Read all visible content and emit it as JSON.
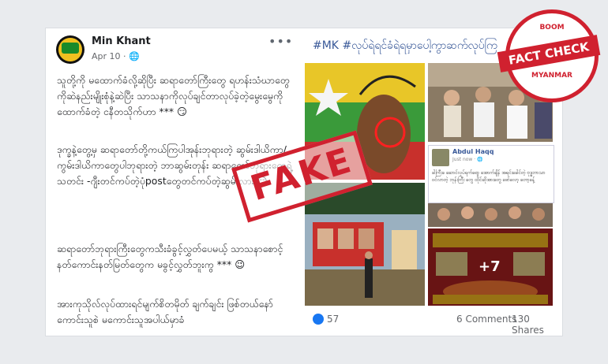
{
  "post": {
    "author": "Min Khant",
    "date": "Apr 10 · ",
    "more": "•••",
    "paragraphs": [
      "သူတို့ကို မထောက်ခံလို့ဆိုပြီး ဆရာတော်ကြီးတွေ ရဟန်းသံဃာတွေကိုဆဲနည်းမျိုးစုံနဲ့ဆဲပြီး သာသနာကိုလုပ်ချင်တာလုပ်ခဲ့တဲ့မွေးမွေကို ထောက်ခံတဲ့ ငနီတသိုက်ဟာ *** 😏",
      "ဒုက္ခနဲ့တွေ့မှ ဆရာတော်တို့ကယ်ကြပါအုန်းဘုရားတဲ့ ဆွမ်းဒါယိကာ/ကွမ်းဒါယိကာတွေပါဘုရားတဲ့ ဘာဆွမ်းတုန်း ဆရာတော်ဘုရားတွေရဲ့ သတင်း -ဂျီးတင်ကပ်တဲ့ပုံpostတွေတင်ကပ်တဲ့ဆွမ်းလား 😏",
      "ဆရာတော်ဘုရားကြီးတွေကသီးခံခွင့်လွှတ်ပေမယ့် သာသနာစောင့်နတ်ကောင်းနတ်မြတ်တွေက မခွင့်လွှတ်ဘူးကွ *** 😉",
      "အားကုသိုလ်လုပ်ထားရင်မျက်စိတမိုတ် ချက်ချင်း ဖြစ်တယ်နော် ကောင်းသူစဲ မကောင်းသူအပါယ်မှာခံ"
    ],
    "hashtags": "#MK #လုပ်ရဲရင်ခံရဲရမှာပေါ့ကွာဆက်လုပ်ကြ",
    "embedded": {
      "name": "Abdul Haqq",
      "time": "Just now · 🌐",
      "text": "ခါကြီးခ ဆောင်လုပ်ရက်ရော့ အောက်ချိန် အရင်းခေါင်တဲ့ ဗုဒ္ဓဘာသာ ဝင်လာတဲ့ ဘုန်းကြီး တွေ ထိုင်ဆိုအားတွေ ဖော်လော့ တော့ခန့်"
    },
    "more_images": "+7",
    "likes": "57",
    "comments": "6 Comments",
    "shares": "130 Shares"
  },
  "stamp": {
    "label": "FAKE"
  },
  "badge": {
    "brand": "BOOM",
    "title": "FACT CHECK",
    "country": "MYANMAR"
  },
  "colors": {
    "stamp_red": "#d0212f",
    "link_blue": "#385898",
    "like_blue": "#1877f2"
  }
}
